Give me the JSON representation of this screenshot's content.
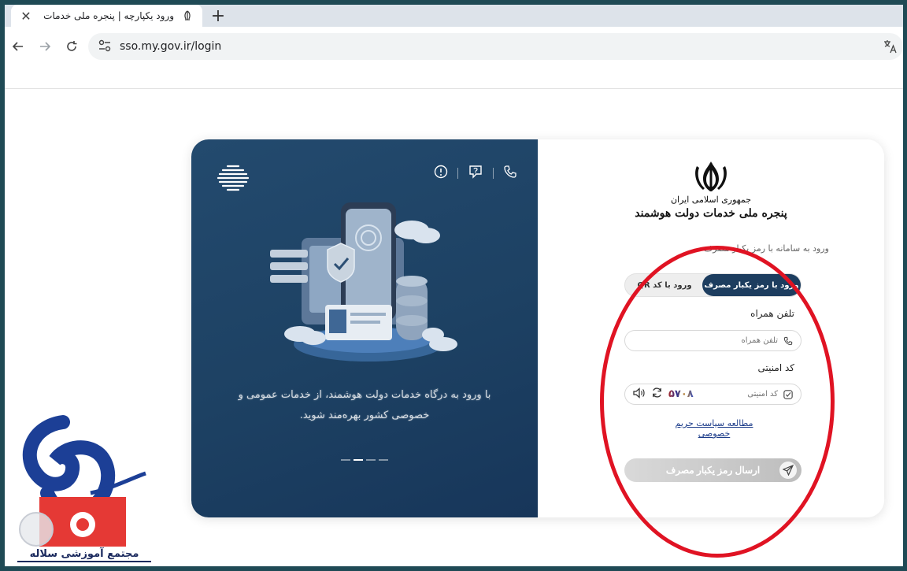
{
  "browser": {
    "tab_title": "ورود یکپارچه | پنجره ملی خدمات",
    "tab_close": "✕",
    "new_tab": "+",
    "url": "sso.my.gov.ir/login"
  },
  "left_panel": {
    "caption": "با ورود به درگاه خدمات دولت هوشمند، از خدمات عمومی و خصوصی کشور بهره‌مند شوید.",
    "slide_dots": 4,
    "active_dot": 1
  },
  "brand": {
    "line1": "جمهوری اسلامی ایران",
    "line2": "پنجره ملی خدمات دولت هوشمند"
  },
  "login": {
    "intro": "ورود به سامانه با رمز یکبار مصرف",
    "tab_active": "ورود با رمز یکبار مصرف",
    "tab_inactive": "ورود با کد QR",
    "phone_label": "تلفن همراه",
    "phone_placeholder": "تلفن همراه",
    "captcha_label": "کد امنیتی",
    "captcha_placeholder": "کد امنیتی",
    "captcha_digits": "۵۷۰۸",
    "privacy_link": "مطالعه سیاست حریم خصوصی",
    "submit_label": "ارسال رمز یکبار مصرف"
  },
  "watermark": {
    "text": "مجتمع آموزشی سلاله"
  },
  "colors": {
    "panel_dark": "#1d4163",
    "tab_active_bg": "#1d3d5f",
    "annotation": "#e01323",
    "link": "#1d3d8a"
  }
}
